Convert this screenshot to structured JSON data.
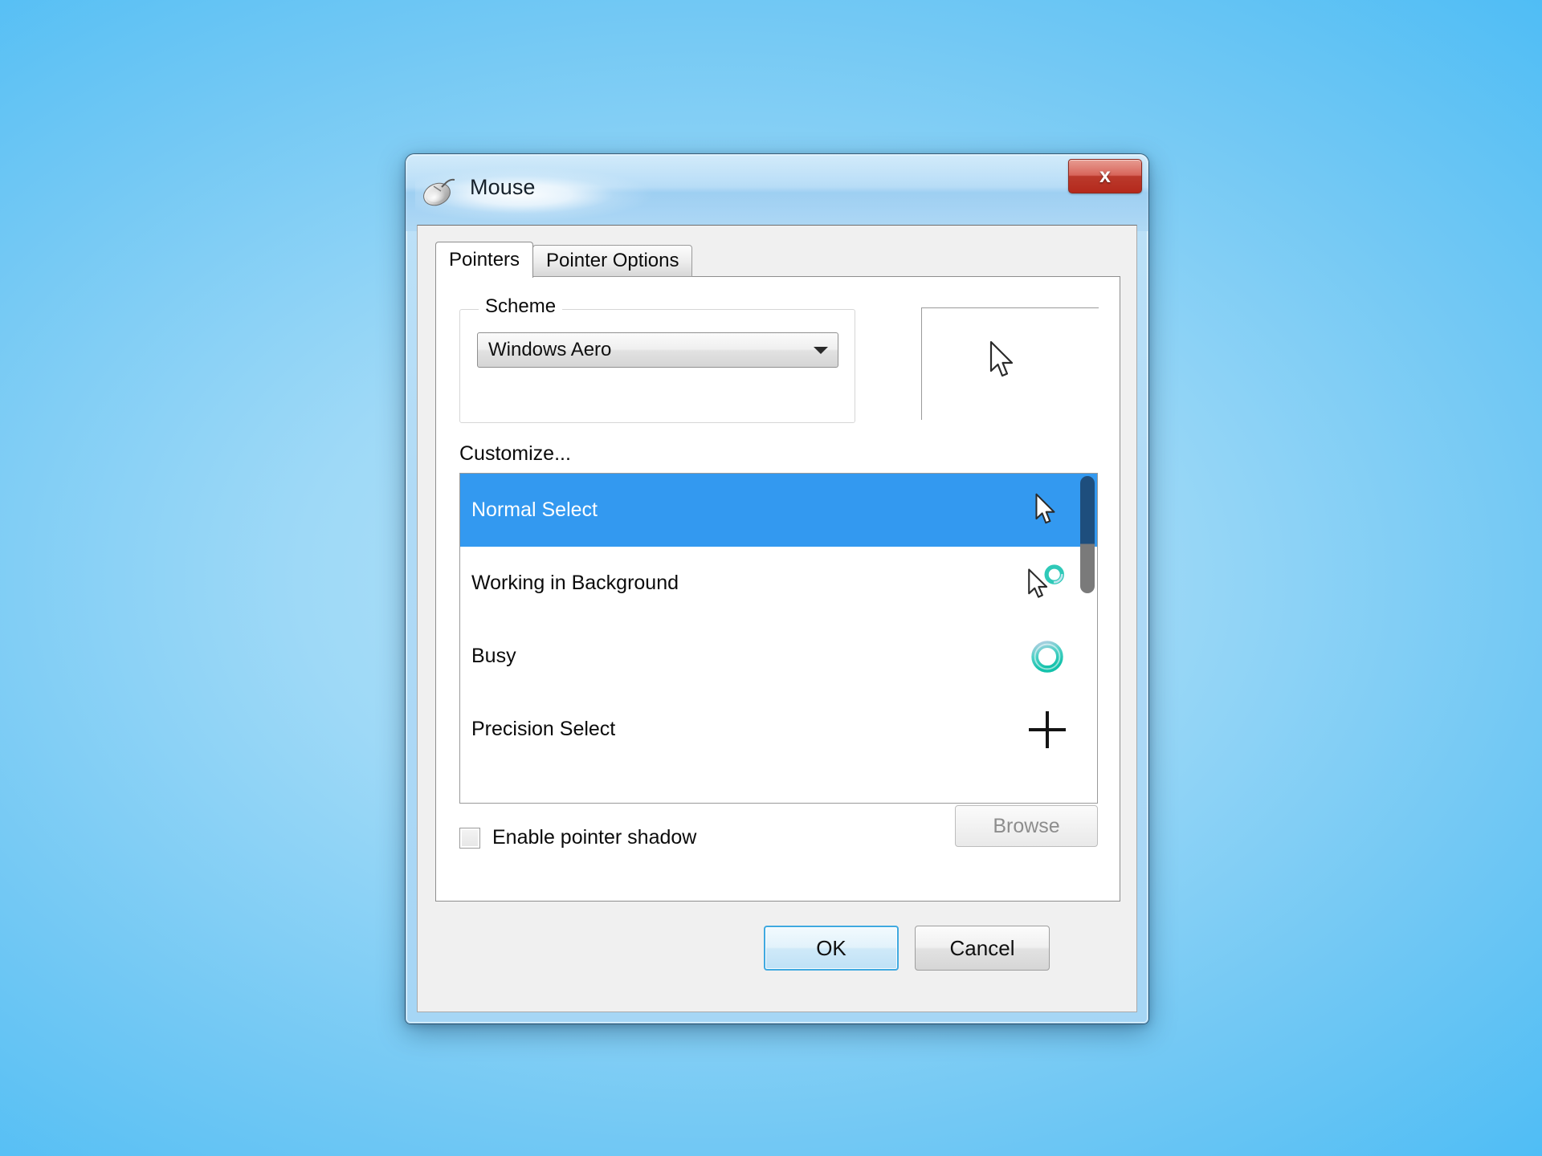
{
  "window": {
    "title": "Mouse",
    "app_icon": "mouse-icon",
    "close_label": "x"
  },
  "tabs": [
    {
      "label": "Pointers",
      "active": true
    },
    {
      "label": "Pointer Options",
      "active": false
    }
  ],
  "scheme": {
    "legend": "Scheme",
    "selected": "Windows Aero",
    "dropdown_icon": "chevron-down-icon"
  },
  "preview": {
    "cursor_icon": "arrow-cursor-icon"
  },
  "customize": {
    "label": "Customize...",
    "rows": [
      {
        "label": "Normal Select",
        "icon": "arrow-cursor-icon",
        "selected": true
      },
      {
        "label": "Working in Background",
        "icon": "arrow-busy-cursor-icon",
        "selected": false
      },
      {
        "label": "Busy",
        "icon": "busy-ring-cursor-icon",
        "selected": false
      },
      {
        "label": "Precision Select",
        "icon": "crosshair-cursor-icon",
        "selected": false
      }
    ]
  },
  "options": {
    "shadow_label": "Enable pointer shadow",
    "shadow_checked": false,
    "browse_label": "Browse"
  },
  "footer": {
    "ok_label": "OK",
    "cancel_label": "Cancel"
  },
  "colors": {
    "selection_blue": "#3399f0",
    "close_red": "#b4291c",
    "default_button_border": "#3fa9e0",
    "busy_ring_teal": "#1fc8b4"
  }
}
